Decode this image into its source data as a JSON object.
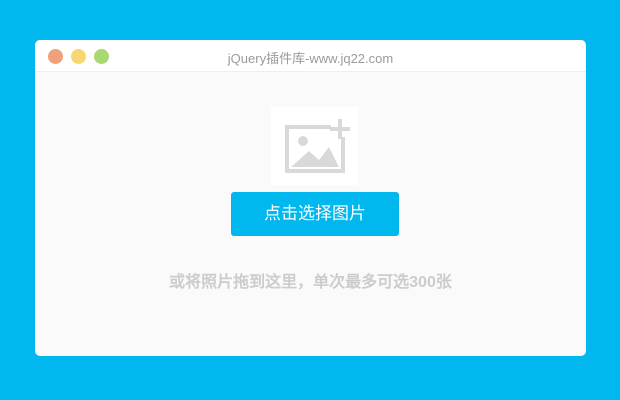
{
  "window": {
    "title": "jQuery插件库-www.jq22.com"
  },
  "uploader": {
    "placeholder_icon": "image-add-icon",
    "button_label": "点击选择图片",
    "hint_text": "或将照片拖到这里，单次最多可选300张"
  },
  "colors": {
    "background": "#00b7ee",
    "button": "#00b7ee",
    "hint_text": "#cccccc",
    "dot_red": "#f0a07b",
    "dot_yellow": "#f7d774",
    "dot_green": "#a7d873"
  }
}
